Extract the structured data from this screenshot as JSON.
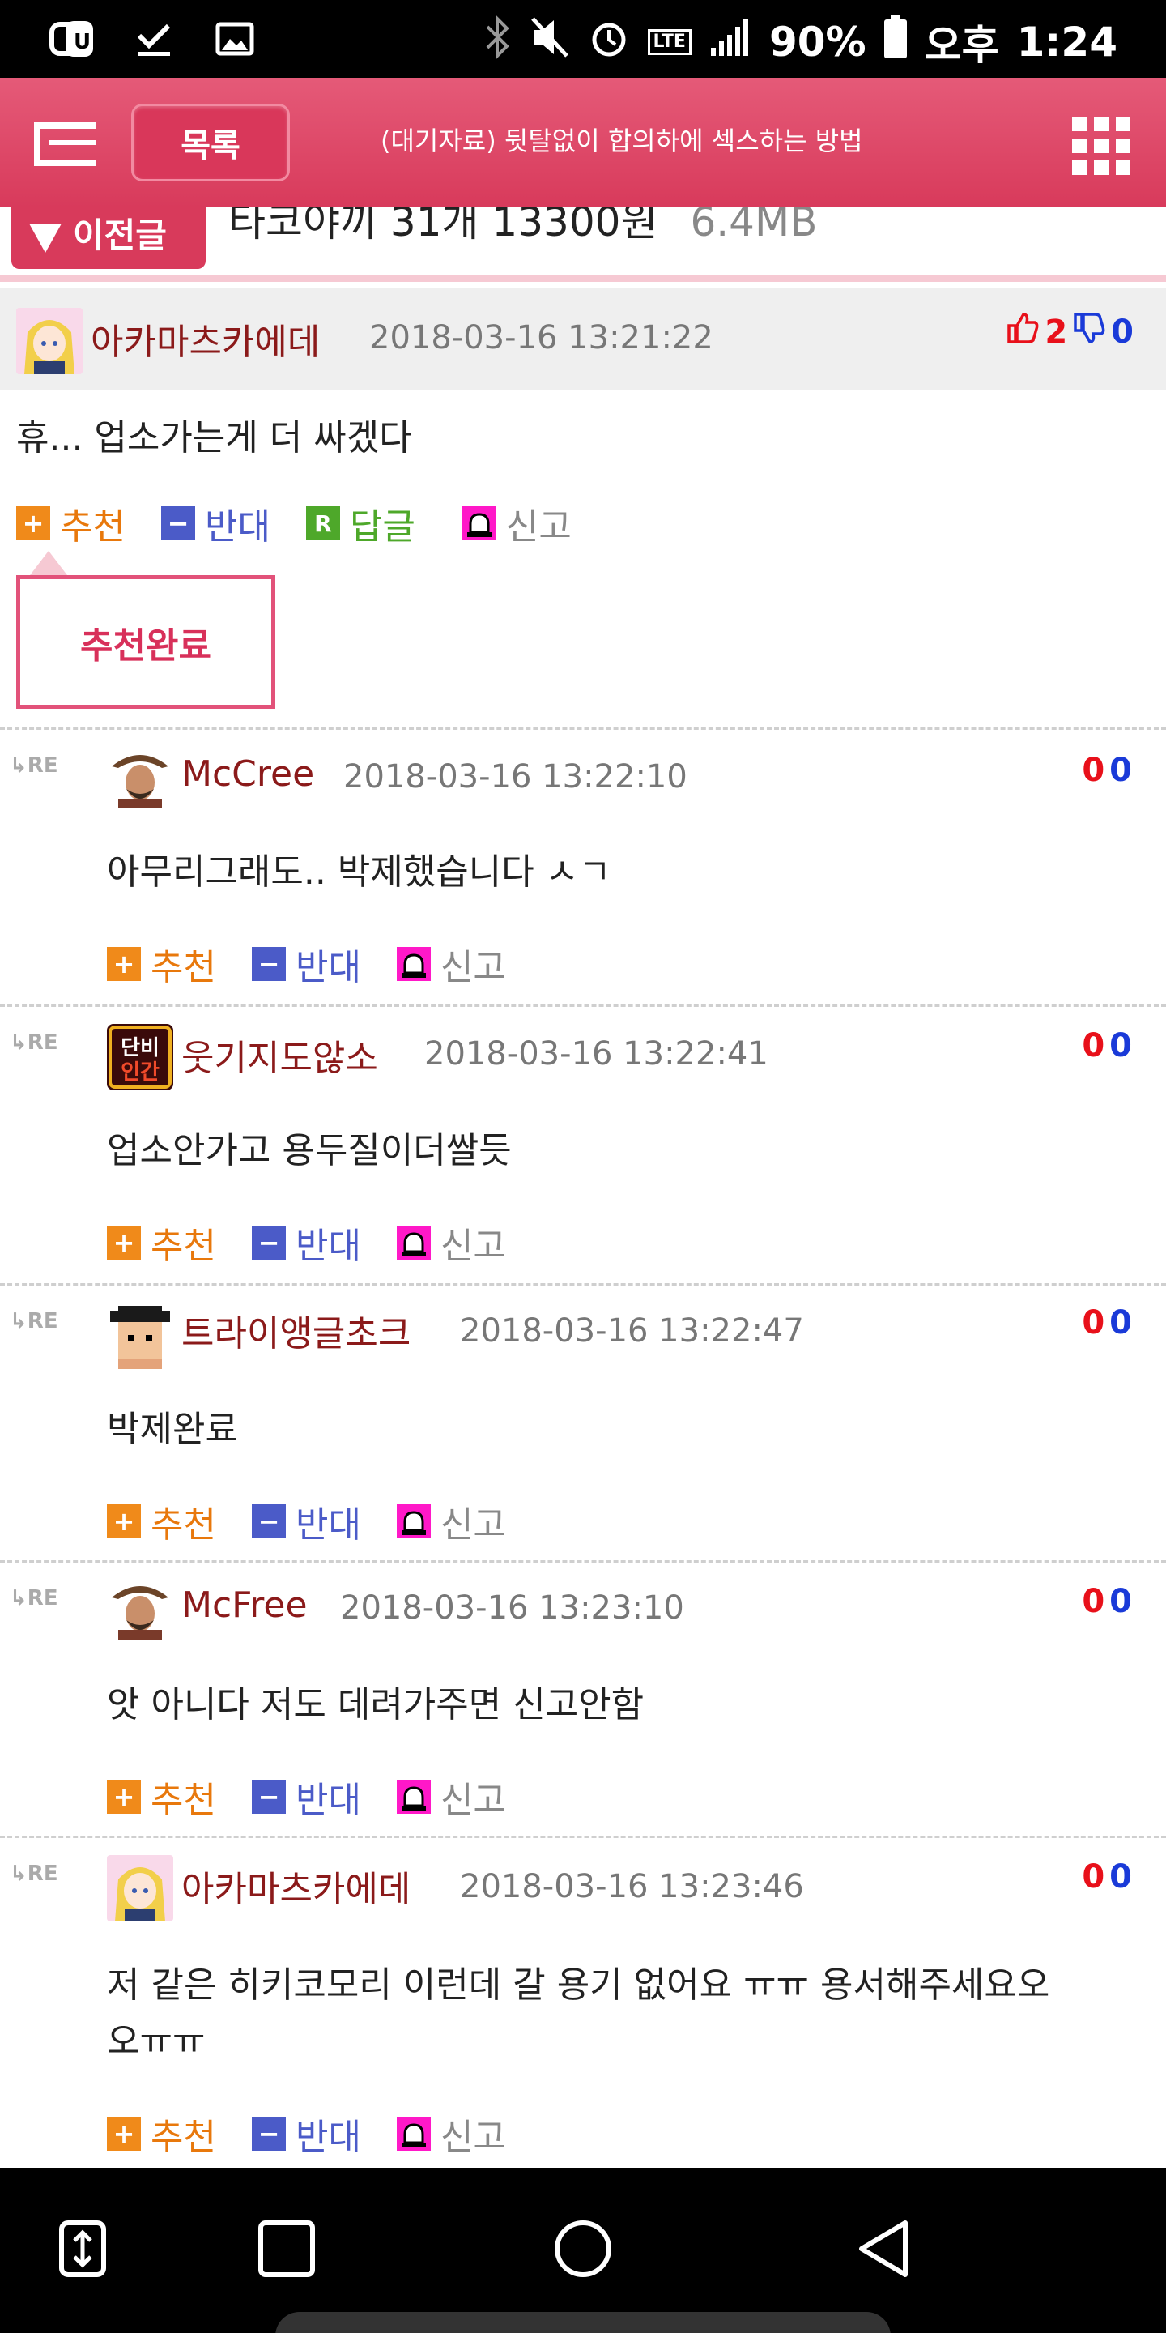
{
  "status_bar": {
    "battery": "90%",
    "ampm": "오후",
    "time": "1:24",
    "network": "LTE"
  },
  "navbar": {
    "list_label": "목록",
    "title": "(대기자료) 뒷탈없이 합의하에 섹스하는 방법"
  },
  "prev_post": {
    "button_label": "이전글",
    "title": "타코야끼 31개 13300원",
    "size": "6.4MB"
  },
  "main_comment": {
    "author": "아카마츠카에데",
    "date": "2018-03-16 13:21:22",
    "likes": "2",
    "dislikes": "0",
    "text": "휴... 업소가는게 더 싸겠다",
    "actions": {
      "recommend": "추천",
      "oppose": "반대",
      "reply": "답글",
      "report": "신고"
    },
    "tooltip": "추천완료"
  },
  "replies": [
    {
      "author": "McCree",
      "date": "2018-03-16 13:22:10",
      "likes": "0",
      "dislikes": "0",
      "text": "아무리그래도.. 박제했습니다 ㅅㄱ"
    },
    {
      "author": "웃기지도않소",
      "date": "2018-03-16 13:22:41",
      "likes": "0",
      "dislikes": "0",
      "text": "업소안가고 용두질이더쌀듯"
    },
    {
      "author": "트라이앵글초크",
      "date": "2018-03-16 13:22:47",
      "likes": "0",
      "dislikes": "0",
      "text": "박제완료"
    },
    {
      "author": "McFree",
      "date": "2018-03-16 13:23:10",
      "likes": "0",
      "dislikes": "0",
      "text": "앗 아니다 저도 데려가주면 신고안함"
    },
    {
      "author": "아카마츠카에데",
      "date": "2018-03-16 13:23:46",
      "likes": "0",
      "dislikes": "0",
      "text_line1": "저 같은 히키코모리 이런데 갈 용기 없어요 ㅠㅠ 용서해주세요오",
      "text_line2": "오ㅠㅠ"
    }
  ],
  "reply_actions": {
    "recommend": "추천",
    "oppose": "반대",
    "report": "신고"
  },
  "re_mark": "RE",
  "colors": {
    "brand": "#d83a5b",
    "author": "#8b1a1a",
    "recommend": "#e8780c",
    "oppose": "#4b5bc8",
    "reply": "#4ea82a",
    "like": "#e8101a",
    "dislike": "#1a3ad8"
  }
}
